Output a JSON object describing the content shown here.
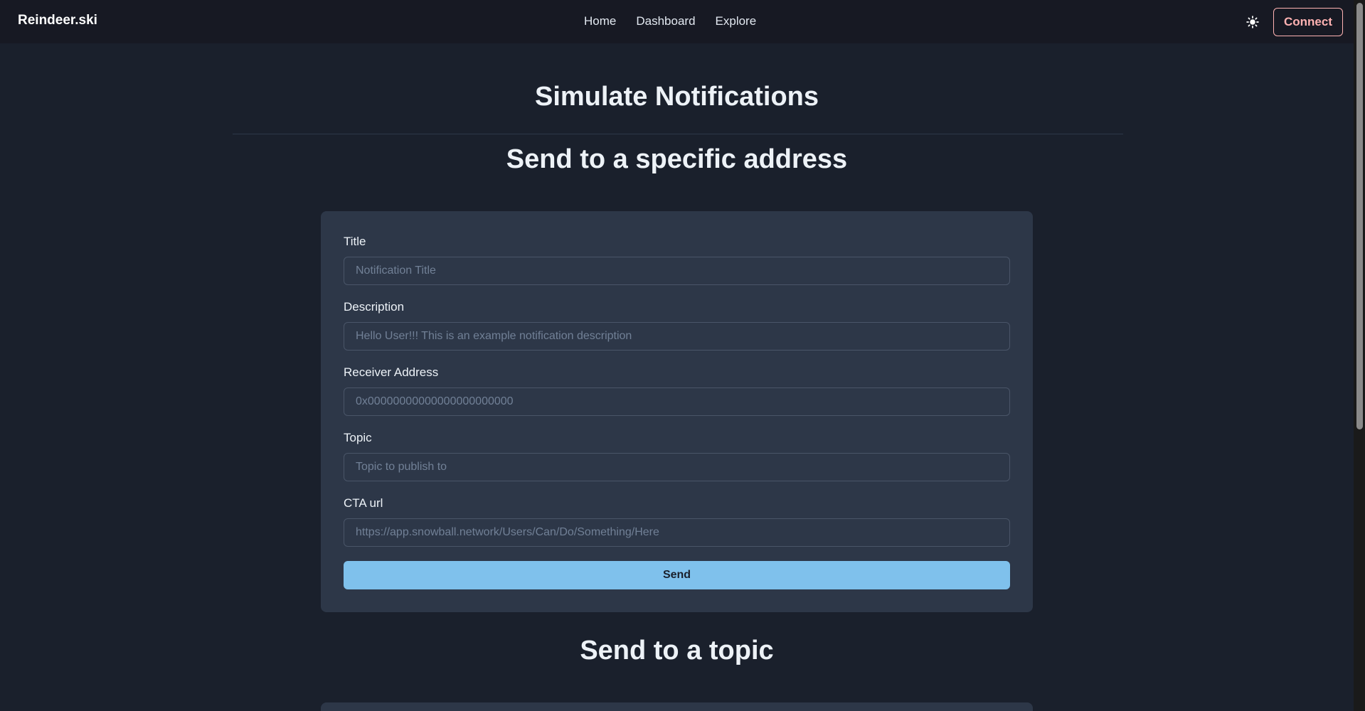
{
  "header": {
    "brand": "Reindeer.ski",
    "nav": [
      {
        "label": "Home"
      },
      {
        "label": "Dashboard"
      },
      {
        "label": "Explore"
      }
    ],
    "theme_toggle_icon": "sun-icon",
    "connect_label": "Connect"
  },
  "main": {
    "title": "Simulate Notifications",
    "section1_title": "Send to a specific address",
    "section2_title": "Send to a topic",
    "form": {
      "title_label": "Title",
      "title_placeholder": "Notification Title",
      "description_label": "Description",
      "description_placeholder": "Hello User!!! This is an example notification description",
      "receiver_label": "Receiver Address",
      "receiver_placeholder": "0x00000000000000000000000",
      "topic_label": "Topic",
      "topic_placeholder": "Topic to publish to",
      "cta_label": "CTA url",
      "cta_placeholder": "https://app.snowball.network/Users/Can/Do/Something/Here",
      "send_label": "Send"
    }
  },
  "colors": {
    "background": "#1a202c",
    "header": "#171923",
    "card": "#2d3748",
    "accent_button": "#7fc1ec",
    "connect_accent": "#feb2b2"
  }
}
